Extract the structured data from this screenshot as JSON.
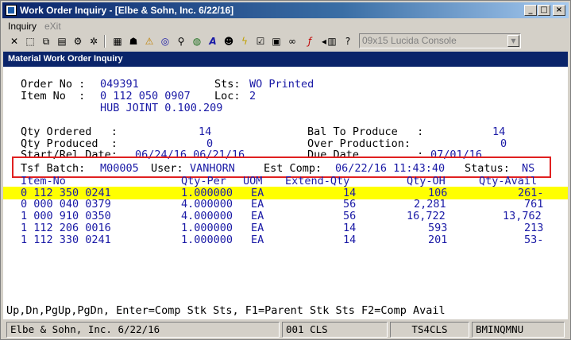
{
  "window": {
    "title": "Work Order Inquiry - [Elbe & Sohn, Inc. 6/22/16]"
  },
  "menu": {
    "inquiry": "Inquiry",
    "exit": "eXit"
  },
  "toolbar": {
    "font_select": "09x15 Lucida Console"
  },
  "panel": {
    "title": "Material Work Order Inquiry"
  },
  "order": {
    "order_no_label": "Order No :",
    "order_no": "049391",
    "sts_label": "Sts:",
    "sts": "WO Printed",
    "item_no_label": "Item No  :",
    "item_no": "0 112 050 0907",
    "loc_label": "Loc:",
    "loc": "2",
    "description": "HUB JOINT 0.100.209"
  },
  "qty": {
    "ordered_label": "Qty Ordered   :",
    "ordered": "14",
    "produced_label": "Qty Produced  :",
    "produced": "0",
    "dates_label": "Start/Rel Date:",
    "dates": "06/24/16 06/21/16",
    "bal_label": "Bal To Produce   :",
    "bal": "14",
    "over_label": "Over Production:",
    "over": "0",
    "due_label": "Due Date         :",
    "due": "07/01/16"
  },
  "tsf": {
    "batch_label": "Tsf Batch:",
    "batch": "M00005",
    "user_label": "User:",
    "user": "VANHORN",
    "est_label": "Est Comp:",
    "est": "06/22/16 11:43:40",
    "status_label": "Status:",
    "status": "NS"
  },
  "table": {
    "headers": [
      "Item-No",
      "Qty-Per",
      "UOM",
      "Extend-Qty",
      "Qty-OH",
      "Qty-Avail"
    ],
    "rows": [
      [
        "0 112 350 0241",
        "1.000000",
        "EA",
        "14",
        "106",
        "261-"
      ],
      [
        "0 000 040 0379",
        "4.000000",
        "EA",
        "56",
        "2,281",
        "761"
      ],
      [
        "1 000 910 0350",
        "4.000000",
        "EA",
        "56",
        "16,722",
        "13,762"
      ],
      [
        "1 112 206 0016",
        "1.000000",
        "EA",
        "14",
        "593",
        "213"
      ],
      [
        "1 112 330 0241",
        "1.000000",
        "EA",
        "14",
        "201",
        "53-"
      ]
    ]
  },
  "help_line": "Up,Dn,PgUp,PgDn, Enter=Comp Stk Sts, F1=Parent Stk Sts F2=Comp Avail",
  "status": {
    "company": "Elbe & Sohn, Inc. 6/22/16",
    "user": "001 CLS",
    "terminal": "TS4CLS",
    "program": "BMINQMNU"
  },
  "colors": {
    "highlight": "#ffff00",
    "value": "#1a1aa6",
    "annotation": "#e02020",
    "header": "#0a246a"
  }
}
